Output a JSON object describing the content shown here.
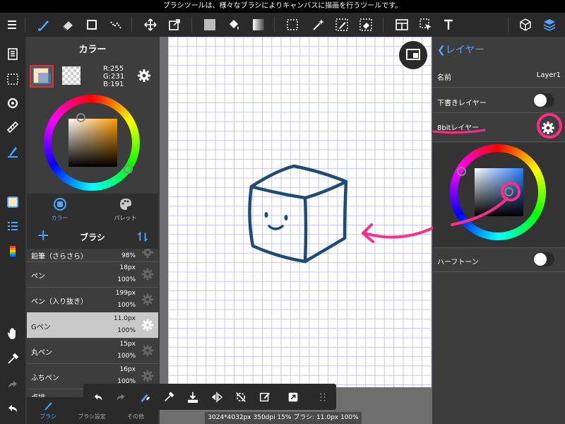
{
  "topbar": {
    "hint": "ブラシツールは、様々なブラシによりキャンバスに描画を行うツールです。"
  },
  "toolbar": {
    "left_icons": [
      "menu-icon",
      "brush-icon",
      "eraser-icon",
      "square-icon",
      "dots-icon"
    ],
    "center_icons": [
      "move-icon",
      "transform-icon",
      "fill-color-icon",
      "bucket-icon",
      "gradient-icon",
      "selection-icon",
      "magic-wand-icon",
      "select-pen-icon",
      "select-eraser-icon",
      "layout-icon",
      "select-arrow-icon",
      "text-icon"
    ],
    "right_icons": [
      "3d-icon",
      "layers-icon"
    ]
  },
  "colors": {
    "accent": "#4da6ff",
    "pink_annotation": "#ff2d88",
    "main_color": "#ffe7bf",
    "line_color": "#1f4a72"
  },
  "color_panel": {
    "title": "カラー",
    "rgb_r": "R:255",
    "rgb_g": "G:231",
    "rgb_b": "B:191",
    "tab_color": "カラー",
    "tab_palette": "パレット"
  },
  "brush_panel": {
    "title": "ブラシ",
    "add": "+",
    "items": [
      {
        "name": "鉛筆（さらさら）",
        "size": "",
        "opacity": "98%"
      },
      {
        "name": "ペン",
        "size": "18px",
        "opacity": "100%"
      },
      {
        "name": "ペン（入り抜き）",
        "size": "199px",
        "opacity": "100%"
      },
      {
        "name": "Gペン",
        "size": "11.0px",
        "opacity": "100%"
      },
      {
        "name": "丸ペン",
        "size": "15px",
        "opacity": "100%"
      },
      {
        "name": "ふちペン",
        "size": "16px",
        "opacity": "100%"
      },
      {
        "name": "点描",
        "size": "",
        "opacity": ""
      }
    ],
    "selected_index": 3
  },
  "bottom_tabs": [
    "ブラシ",
    "ブラシ設定",
    "その他"
  ],
  "status": {
    "text": "3024*4032px 350dpi 15% ブラシ: 11.0px 100%"
  },
  "layer_panel": {
    "back_label": "レイヤー",
    "name_label": "名前",
    "name_value": "Layer1",
    "draft_label": "下書きレイヤー",
    "bit_label": "8bitレイヤー",
    "halftone_label": "ハーフトーン"
  }
}
